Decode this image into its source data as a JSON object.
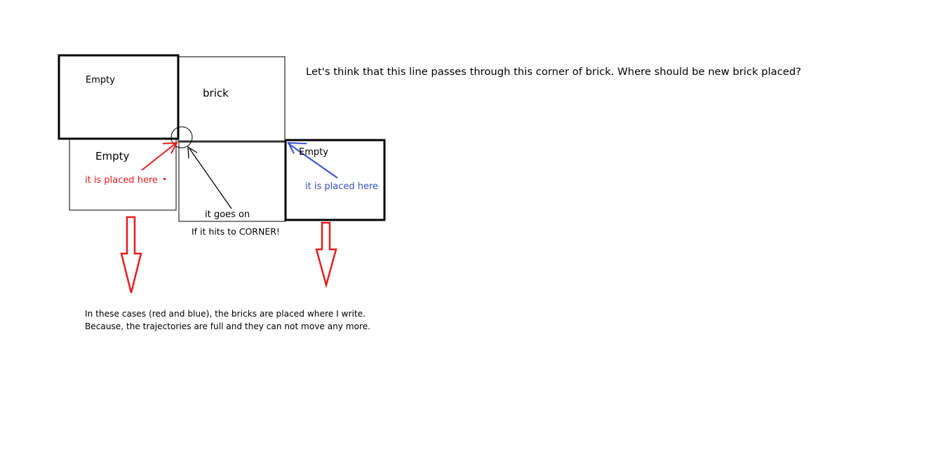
{
  "colors": {
    "red": "#e81c1c",
    "blue": "#3a4fc8",
    "black": "#000000"
  },
  "labels": {
    "top_left_box": "Empty",
    "brick_box": "brick",
    "lower_left_box": "Empty",
    "right_box": "Empty",
    "red_note": "it is placed here",
    "blue_note": "it is placed here",
    "goes_on": "it goes on",
    "corner_note": "If it hits to CORNER!",
    "question": "Let's think that this line passes through this corner of brick. Where should be new brick placed?",
    "explanation_line1": "In these cases (red and blue), the bricks are placed where I write.",
    "explanation_line2": "Because, the trajectories are full and they can not move any more."
  }
}
